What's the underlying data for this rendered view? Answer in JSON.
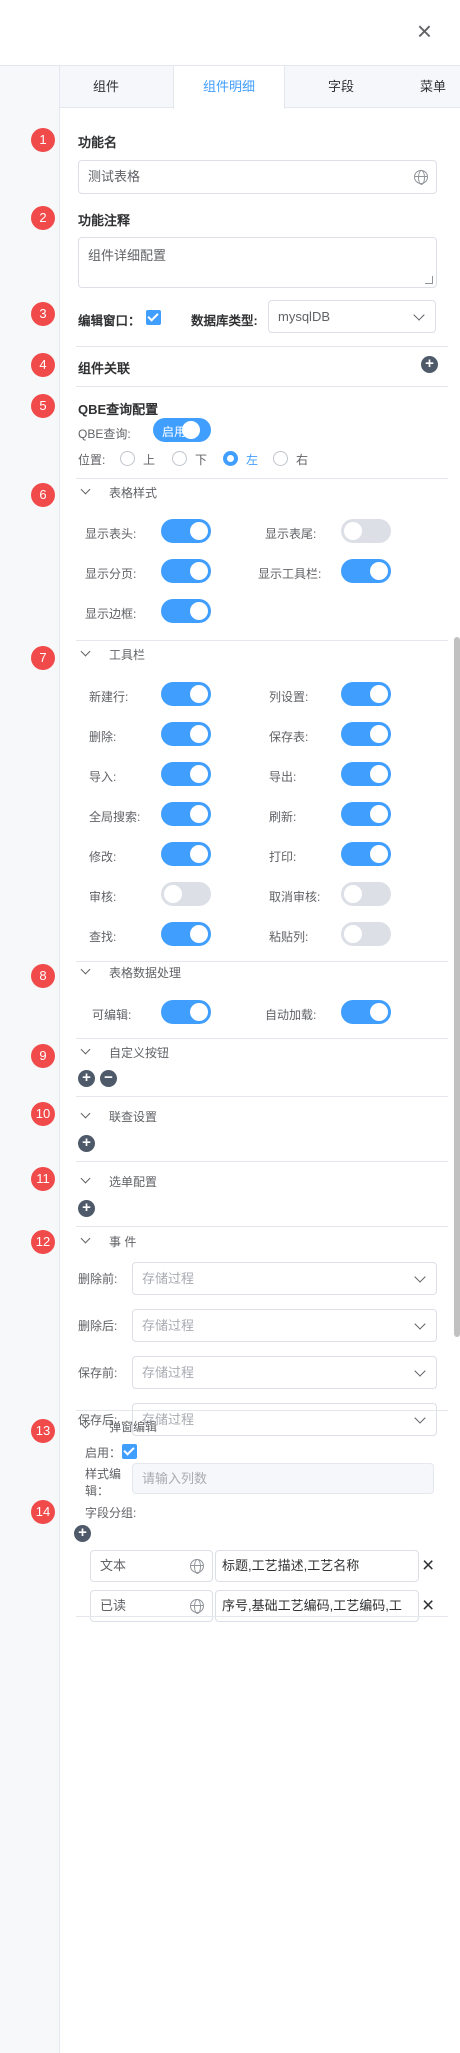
{
  "header": {
    "close_icon": "×"
  },
  "tabs": [
    "组件",
    "组件明细",
    "字段",
    "菜单"
  ],
  "badges": [
    "1",
    "2",
    "3",
    "4",
    "5",
    "6",
    "7",
    "8",
    "9",
    "10",
    "11",
    "12",
    "13",
    "14"
  ],
  "func_name": {
    "label": "功能名",
    "value": "测试表格"
  },
  "func_note": {
    "label": "功能注释",
    "value": "组件详细配置"
  },
  "edit_window": {
    "label": "编辑窗口：",
    "db_label": "数据库类型:",
    "db_value": "mysqlDB"
  },
  "component_link": {
    "label": "组件关联"
  },
  "qbe": {
    "title": "QBE查询配置",
    "query_label": "QBE查询:",
    "switch_text": "启用",
    "position_label": "位置:",
    "options": [
      "上",
      "下",
      "左",
      "右"
    ],
    "selected": "左"
  },
  "table_style": {
    "title": "表格样式",
    "items": [
      {
        "label": "显示表头:",
        "on": true
      },
      {
        "label": "显示表尾:",
        "on": false
      },
      {
        "label": "显示分页:",
        "on": true
      },
      {
        "label": "显示工具栏:",
        "on": true
      },
      {
        "label": "显示边框:",
        "on": true
      }
    ]
  },
  "toolbar": {
    "title": "工具栏",
    "items": [
      {
        "label": "新建行:",
        "on": true
      },
      {
        "label": "列设置:",
        "on": true
      },
      {
        "label": "删除:",
        "on": true
      },
      {
        "label": "保存表:",
        "on": true
      },
      {
        "label": "导入:",
        "on": true
      },
      {
        "label": "导出:",
        "on": true
      },
      {
        "label": "全局搜索:",
        "on": true
      },
      {
        "label": "刷新:",
        "on": true
      },
      {
        "label": "修改:",
        "on": true
      },
      {
        "label": "打印:",
        "on": true
      },
      {
        "label": "审核:",
        "on": false
      },
      {
        "label": "取消审核:",
        "on": false
      },
      {
        "label": "查找:",
        "on": true
      },
      {
        "label": "粘贴列:",
        "on": false
      }
    ]
  },
  "data_process": {
    "title": "表格数据处理",
    "items": [
      {
        "label": "可编辑:",
        "on": true
      },
      {
        "label": "自动加载:",
        "on": true
      }
    ]
  },
  "custom_buttons": {
    "title": "自定义按钮"
  },
  "linked_query": {
    "title": "联查设置"
  },
  "select_config": {
    "title": "选单配置"
  },
  "events": {
    "title": "事 件",
    "items": [
      {
        "label": "删除前:",
        "placeholder": "存储过程"
      },
      {
        "label": "删除后:",
        "placeholder": "存储过程"
      },
      {
        "label": "保存前:",
        "placeholder": "存储过程"
      },
      {
        "label": "保存后:",
        "placeholder": "存储过程"
      }
    ]
  },
  "popup_edit": {
    "title": "弹窗编辑",
    "enable_label": "启用：",
    "style_label_1": "样式编",
    "style_label_2": "辑：",
    "style_placeholder": "请输入列数"
  },
  "field_groups": {
    "label": "字段分组:",
    "rows": [
      {
        "name": "文本",
        "fields": "标题,工艺描述,工艺名称"
      },
      {
        "name": "已读",
        "fields": "序号,基础工艺编码,工艺编码,工"
      }
    ]
  },
  "colors": {
    "accent": "#409eff",
    "badge": "#f04a4a",
    "switch_off": "#dcdfe6"
  }
}
